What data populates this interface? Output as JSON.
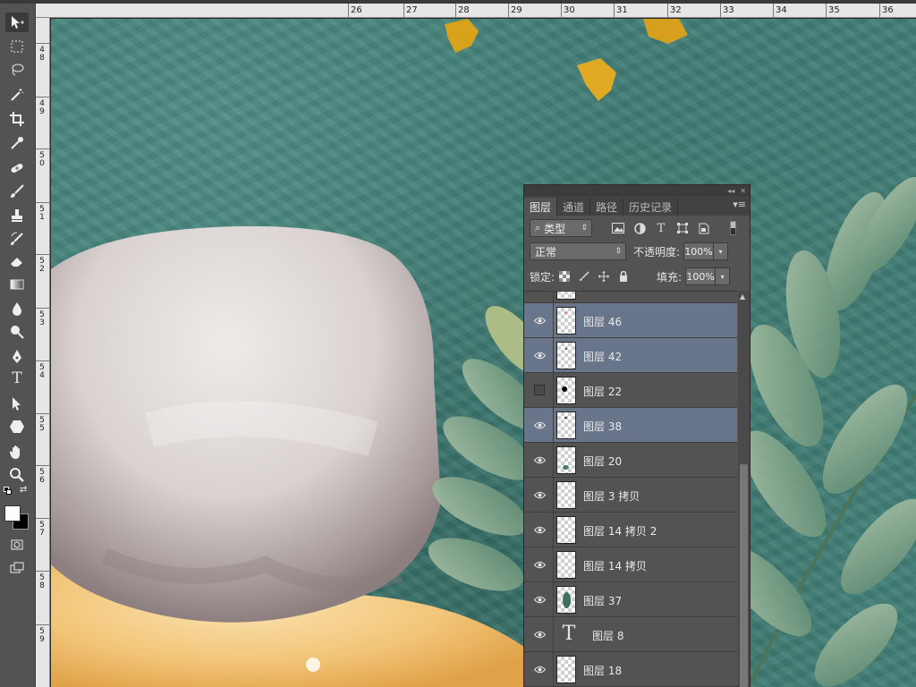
{
  "ruler_top": {
    "labels": [
      "26",
      "27",
      "28",
      "29",
      "30",
      "31",
      "32",
      "33",
      "34",
      "35",
      "36"
    ]
  },
  "ruler_left": {
    "labels": [
      "4 8",
      "4 9",
      "5 0",
      "5 1",
      "5 2",
      "5 3",
      "5 4",
      "5 5",
      "5 6",
      "5 7",
      "5 8",
      "5 9"
    ]
  },
  "toolbar": {
    "tools": [
      "move-tool",
      "marquee-tool",
      "lasso-tool",
      "magic-wand-tool",
      "crop-tool",
      "eyedropper-tool",
      "healing-brush-tool",
      "brush-tool",
      "clone-stamp-tool",
      "history-brush-tool",
      "eraser-tool",
      "gradient-tool",
      "blur-tool",
      "dodge-tool",
      "pen-tool",
      "type-tool",
      "path-selection-tool",
      "shape-tool",
      "hand-tool",
      "zoom-tool",
      "swap-colors",
      "color-swatches",
      "quick-mask",
      "screen-mode"
    ],
    "type_glyph": "T"
  },
  "panel": {
    "tabs": [
      {
        "label": "图层",
        "active": true
      },
      {
        "label": "通道",
        "active": false
      },
      {
        "label": "路径",
        "active": false
      },
      {
        "label": "历史记录",
        "active": false
      }
    ],
    "filter_label": "类型",
    "filter_type_glyph": "T",
    "blend_mode": "正常",
    "opacity_label": "不透明度:",
    "opacity_value": "100%",
    "lock_label": "锁定:",
    "fill_label": "填充:",
    "fill_value": "100%",
    "layers": [
      {
        "name": "图层 46",
        "visible": true,
        "selected": true,
        "type": "pixel"
      },
      {
        "name": "图层 42",
        "visible": true,
        "selected": true,
        "type": "pixel"
      },
      {
        "name": "图层 22",
        "visible": false,
        "selected": false,
        "type": "pixel"
      },
      {
        "name": "图层 38",
        "visible": true,
        "selected": true,
        "type": "pixel"
      },
      {
        "name": "图层 20",
        "visible": true,
        "selected": false,
        "type": "pixel"
      },
      {
        "name": "图层 3 拷贝",
        "visible": true,
        "selected": false,
        "type": "pixel"
      },
      {
        "name": "图层 14 拷贝 2",
        "visible": true,
        "selected": false,
        "type": "pixel"
      },
      {
        "name": "图层 14 拷贝",
        "visible": true,
        "selected": false,
        "type": "pixel"
      },
      {
        "name": "图层 37",
        "visible": true,
        "selected": false,
        "type": "pixel"
      },
      {
        "name": "图层 8",
        "visible": true,
        "selected": false,
        "type": "text"
      },
      {
        "name": "图层 18",
        "visible": true,
        "selected": false,
        "type": "pixel"
      }
    ],
    "type_layer_glyph": "T"
  },
  "colors": {
    "canvas_teal": "#417e76",
    "selected_layer": "#68758a",
    "panel_bg": "#535353",
    "leaf_green": "#7ea088",
    "gold": "#d9a21b"
  }
}
